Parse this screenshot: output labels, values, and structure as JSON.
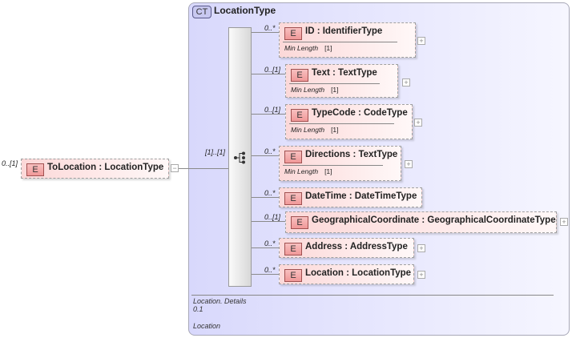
{
  "root": {
    "badge": "E",
    "name": "ToLocation",
    "type": ": LocationType",
    "cardinality": "0..[1]",
    "toggle": "−"
  },
  "complex_type": {
    "badge": "CT",
    "name": "LocationType",
    "sequence_cardinality": "[1]..[1]"
  },
  "children": [
    {
      "badge": "E",
      "name": "ID",
      "type": ": IdentifierType",
      "cardinality": "0..*",
      "facet_label": "Min Length",
      "facet_value": "[1]",
      "toggle": "+"
    },
    {
      "badge": "E",
      "name": "Text",
      "type": ": TextType",
      "cardinality": "0..[1]",
      "facet_label": "Min Length",
      "facet_value": "[1]",
      "toggle": "+"
    },
    {
      "badge": "E",
      "name": "TypeCode",
      "type": ": CodeType",
      "cardinality": "0..[1]",
      "facet_label": "Min Length",
      "facet_value": "[1]",
      "toggle": "+"
    },
    {
      "badge": "E",
      "name": "Directions",
      "type": ": TextType",
      "cardinality": "0..*",
      "facet_label": "Min Length",
      "facet_value": "[1]",
      "toggle": "+"
    },
    {
      "badge": "E",
      "name": "DateTime",
      "type": ": DateTimeType",
      "cardinality": "0..*"
    },
    {
      "badge": "E",
      "name": "GeographicalCoordinate",
      "type": ": GeographicalCoordinateType",
      "cardinality": "0..[1]",
      "toggle": "+"
    },
    {
      "badge": "E",
      "name": "Address",
      "type": ": AddressType",
      "cardinality": "0..*",
      "toggle": "+"
    },
    {
      "badge": "E",
      "name": "Location",
      "type": ": LocationType",
      "cardinality": "0..*",
      "toggle": "+"
    }
  ],
  "footer": {
    "line1": "Location. Details",
    "line2": "0.1",
    "line3": "Location"
  }
}
